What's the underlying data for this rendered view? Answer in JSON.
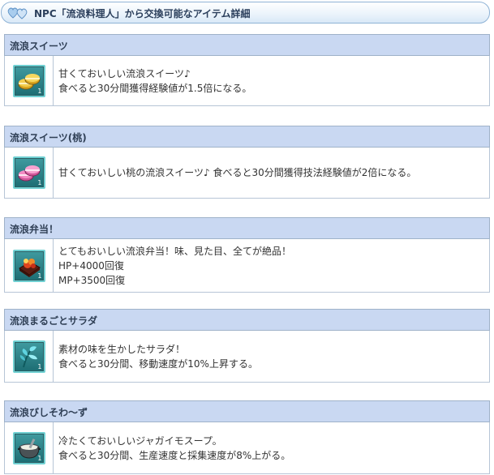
{
  "header": {
    "title": "NPC「流浪料理人」から交換可能なアイテム詳細",
    "icon": "hearts-icon"
  },
  "items": [
    {
      "name": "流浪スイーツ",
      "icon": "gold-macaron-icon",
      "quantity": "1",
      "lines": [
        "甘くておいしい流浪スイーツ♪",
        "食べると30分間獲得経験値が1.5倍になる。"
      ]
    },
    {
      "name": "流浪スイーツ(桃)",
      "icon": "pink-macaron-icon",
      "quantity": "1",
      "lines": [
        "甘くておいしい桃の流浪スイーツ♪ 食べると30分間獲得技法経験値が2倍になる。"
      ]
    },
    {
      "name": "流浪弁当！",
      "icon": "bento-box-icon",
      "quantity": "1",
      "lines": [
        "とてもおいしい流浪弁当！味、見た目、全てが絶品！",
        "HP+4000回復",
        "MP+3500回復"
      ]
    },
    {
      "name": "流浪まるごとサラダ",
      "icon": "salad-leaf-icon",
      "quantity": "1",
      "lines": [
        "素材の味を生かしたサラダ！",
        "食べると30分間、移動速度が10%上昇する。"
      ]
    },
    {
      "name": "流浪びしそわ～ず",
      "icon": "soup-pot-icon",
      "quantity": "1",
      "lines": [
        "冷たくておいしいジャガイモスープ。",
        "食べると30分間、生産速度と採集速度が8%上がる。"
      ]
    }
  ]
}
